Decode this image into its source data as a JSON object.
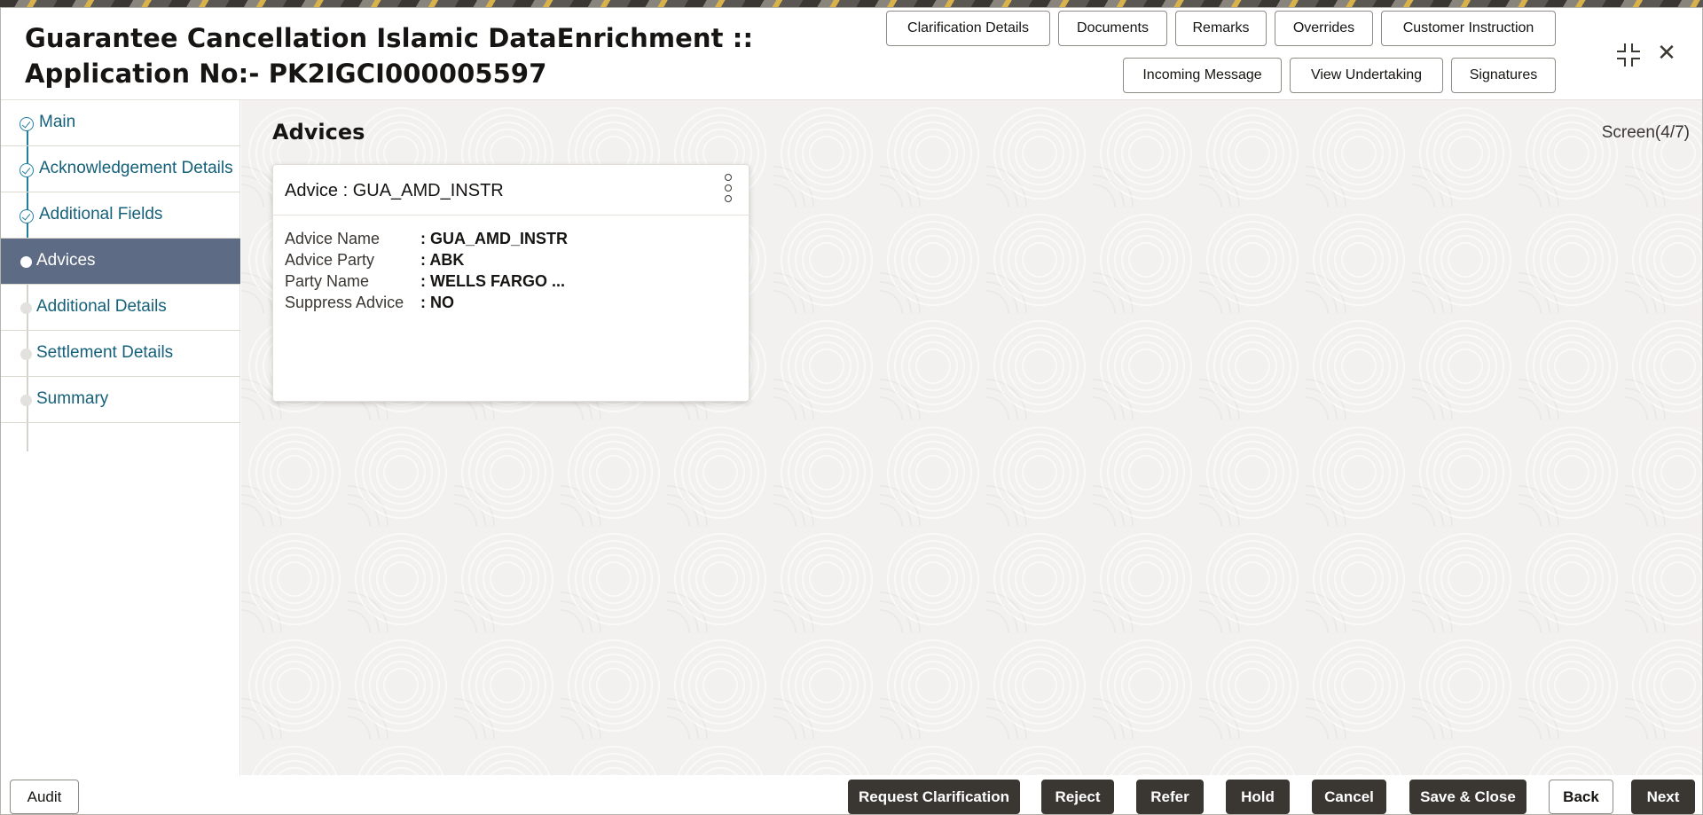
{
  "header": {
    "title_line1": "Guarantee Cancellation Islamic DataEnrichment ::",
    "title_line2": "Application No:- PK2IGCI000005597",
    "buttons_row1": [
      "Clarification Details",
      "Documents",
      "Remarks",
      "Overrides",
      "Customer Instruction"
    ],
    "buttons_row2": [
      "Incoming Message",
      "View Undertaking",
      "Signatures"
    ],
    "icons": [
      "expand-icon",
      "close-icon"
    ],
    "close_glyph": "✕"
  },
  "sidebar": {
    "items": [
      {
        "label": "Main",
        "state": "done"
      },
      {
        "label": "Acknowledgement Details",
        "state": "done"
      },
      {
        "label": "Additional Fields",
        "state": "done"
      },
      {
        "label": "Advices",
        "state": "current"
      },
      {
        "label": "Additional Details",
        "state": "todo"
      },
      {
        "label": "Settlement Details",
        "state": "todo"
      },
      {
        "label": "Summary",
        "state": "todo"
      }
    ]
  },
  "main": {
    "title": "Advices",
    "screen_indicator": "Screen(4/7)",
    "card": {
      "title": "Advice : GUA_AMD_INSTR",
      "fields": [
        {
          "label": "Advice Name",
          "value": ": GUA_AMD_INSTR"
        },
        {
          "label": "Advice Party",
          "value": ": ABK"
        },
        {
          "label": "Party Name",
          "value": ": WELLS FARGO ..."
        },
        {
          "label": "Suppress Advice",
          "value": ": NO"
        }
      ]
    }
  },
  "footer": {
    "audit": "Audit",
    "request_clarification": "Request Clarification",
    "reject": "Reject",
    "refer": "Refer",
    "hold": "Hold",
    "cancel": "Cancel",
    "save_close": "Save & Close",
    "back": "Back",
    "next": "Next"
  },
  "colors": {
    "active_nav": "#5d6b84",
    "link_text": "#15607a",
    "primary_button": "#3a3632"
  }
}
